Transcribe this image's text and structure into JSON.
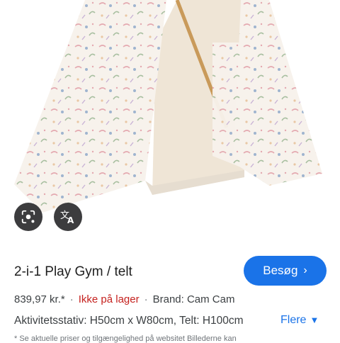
{
  "product": {
    "title": "2-i-1 Play Gym / telt",
    "price": "839,97 kr.*",
    "stock_status": "Ikke på lager",
    "brand": "Brand: Cam Cam",
    "description": "Aktivitetsstativ: H50cm x W80cm, Telt: H100cm",
    "disclaimer": "* Se aktuelle priser og tilgængelighed på websitet Billederne kan"
  },
  "actions": {
    "visit_label": "Besøg",
    "more_label": "Flere"
  },
  "icons": {
    "lens": "camera-lens-icon",
    "translate": "translate-icon",
    "visit_chevron": "chevron-right-icon",
    "more_chevron": "chevron-down-icon"
  },
  "colors": {
    "accent": "#1a73e8",
    "out_of_stock": "#c5221f",
    "icon_button_bg": "#3c3c3e"
  }
}
